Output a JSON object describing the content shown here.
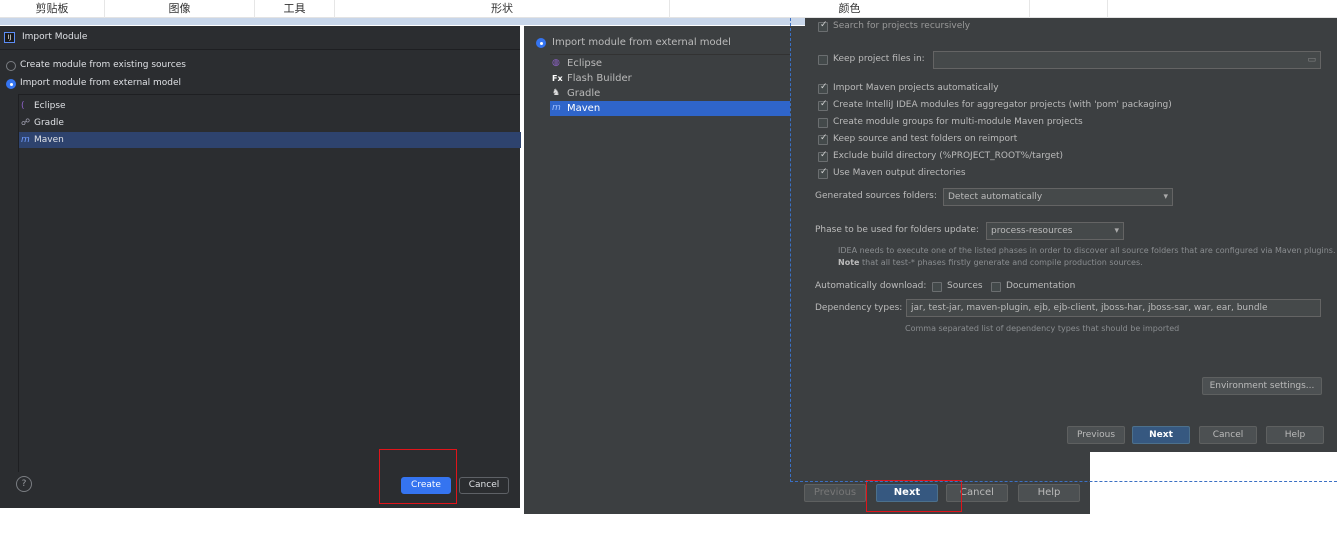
{
  "toolbar": {
    "groups": [
      "剪贴板",
      "图像",
      "工具",
      "形状",
      "颜色"
    ]
  },
  "left_dialog": {
    "title": "Import Module",
    "option_existing": "Create module from existing sources",
    "option_external": "Import module from external model",
    "models": [
      "Eclipse",
      "Gradle",
      "Maven"
    ],
    "selected_model": "Maven",
    "help": "?",
    "create_button": "Create",
    "cancel_button": "Cancel"
  },
  "middle_dialog": {
    "option_external": "Import module from external model",
    "models": [
      "Eclipse",
      "Flash Builder",
      "Gradle",
      "Maven"
    ],
    "previous_button": "Previous",
    "next_button": "Next",
    "cancel_button": "Cancel",
    "help_button": "Help"
  },
  "maven_settings": {
    "search_recursively": "Search for projects recursively",
    "keep_project_files": "Keep project files in:",
    "import_auto": "Import Maven projects automatically",
    "create_modules": "Create IntelliJ IDEA modules for aggregator projects (with 'pom' packaging)",
    "create_groups": "Create module groups for multi-module Maven projects",
    "keep_source": "Keep source and test folders on reimport",
    "exclude_build": "Exclude build directory (%PROJECT_ROOT%/target)",
    "use_output": "Use Maven output directories",
    "generated_label": "Generated sources folders:",
    "generated_value": "Detect automatically",
    "phase_label": "Phase to be used for folders update:",
    "phase_value": "process-resources",
    "phase_note1": "IDEA needs to execute one of the listed phases in order to discover all source folders that are configured via Maven plugins.",
    "phase_note2_bold": "Note",
    "phase_note2": " that all test-* phases firstly generate and compile production sources.",
    "auto_download_label": "Automatically download:",
    "sources": "Sources",
    "documentation": "Documentation",
    "dep_types_label": "Dependency types:",
    "dep_types_value": "jar, test-jar, maven-plugin, ejb, ejb-client, jboss-har, jboss-sar, war, ear, bundle",
    "dep_types_hint": "Comma separated list of dependency types that should be imported",
    "env_button": "Environment settings...",
    "previous_button": "Previous",
    "next_button": "Next",
    "cancel_button": "Cancel",
    "help_button": "Help"
  },
  "colors": {
    "accent": "#3574f0",
    "highlight": "#e0141a"
  }
}
